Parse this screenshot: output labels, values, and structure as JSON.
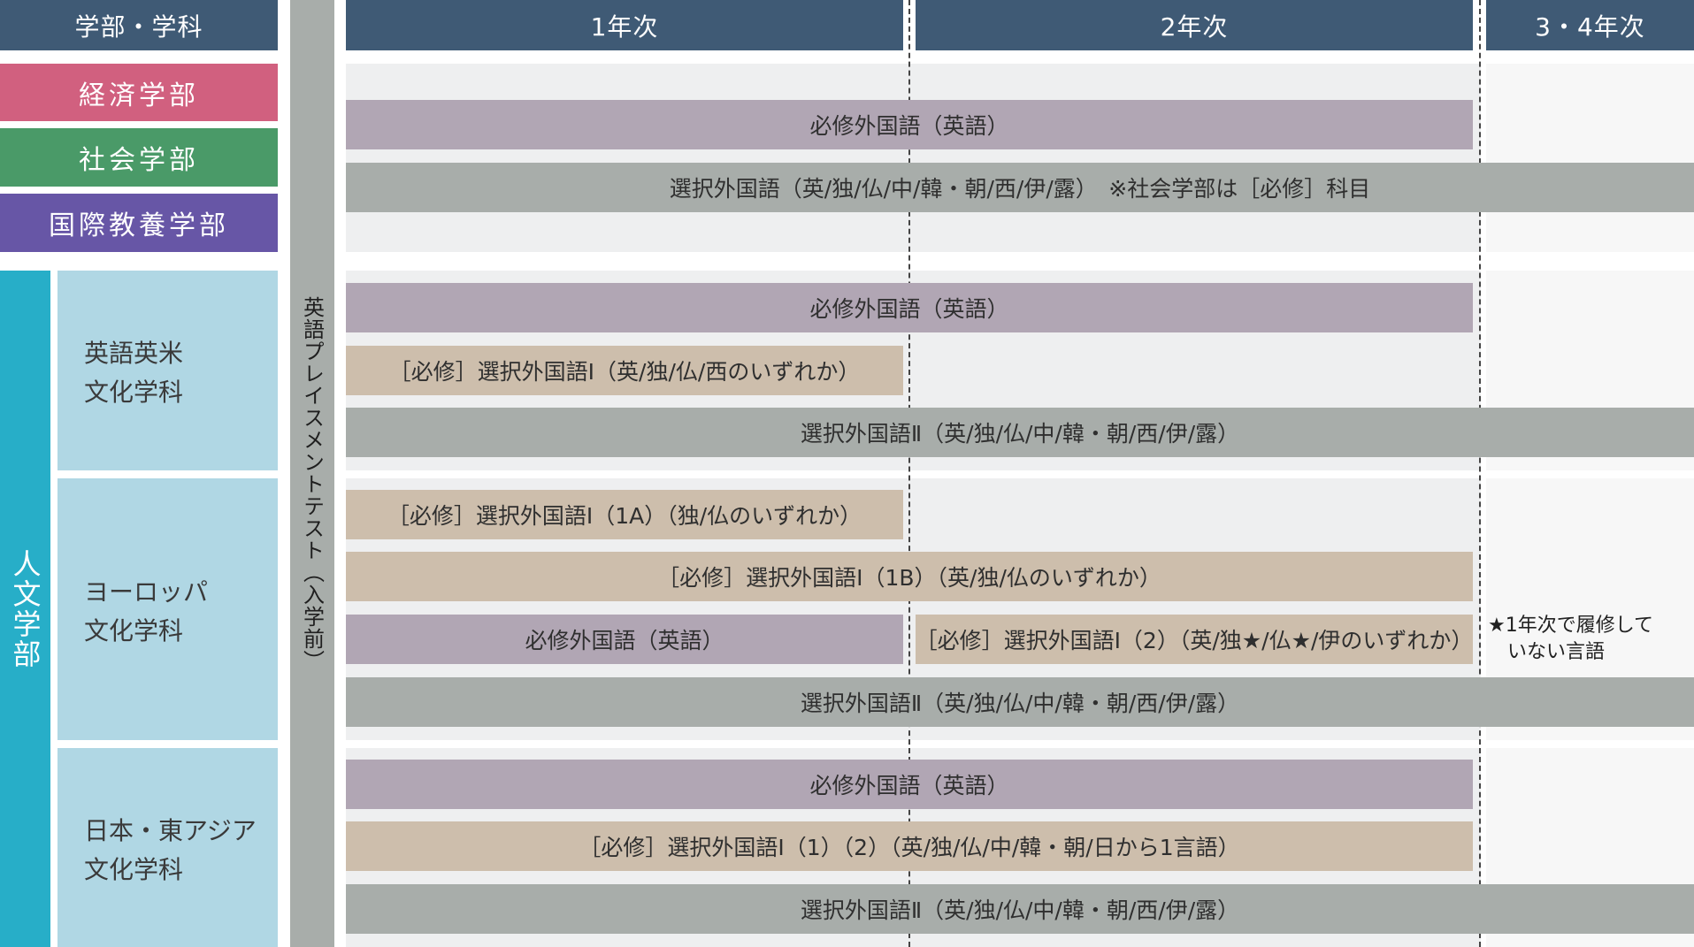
{
  "header": {
    "dept_label": "学部・学科",
    "year1": "1年次",
    "year2": "2年次",
    "year34": "3・4年次"
  },
  "departments": {
    "economics": "経済学部",
    "sociology": "社会学部",
    "liberal_arts": "国際教養学部",
    "humanities": "人文学部"
  },
  "subdepartments": {
    "english": [
      "英語英米",
      "文化学科"
    ],
    "europe": [
      "ヨーロッパ",
      "文化学科"
    ],
    "japan": [
      "日本・東アジア",
      "文化学科"
    ]
  },
  "placement_test": "英語プレイスメントテスト（入学前）",
  "courses": {
    "g1_required_english": "必修外国語（英語）",
    "g1_elective": "選択外国語（英/独/仏/中/韓・朝/西/伊/露）　※社会学部は［必修］科目",
    "g2_required_english": "必修外国語（英語）",
    "g2_elective_1": "［必修］選択外国語Ⅰ（英/独/仏/西のいずれか）",
    "g2_elective_2": "選択外国語Ⅱ（英/独/仏/中/韓・朝/西/伊/露）",
    "g3_elective_1a": "［必修］選択外国語Ⅰ（1A）（独/仏のいずれか）",
    "g3_elective_1b": "［必修］選択外国語Ⅰ（1B）（英/独/仏のいずれか）",
    "g3_required_english": "必修外国語（英語）",
    "g3_elective_2yr": "［必修］選択外国語Ⅰ（2）（英/独★/仏★/伊のいずれか）",
    "g3_elective_2": "選択外国語Ⅱ（英/独/仏/中/韓・朝/西/伊/露）",
    "g4_required_english": "必修外国語（英語）",
    "g4_elective_1": "［必修］選択外国語Ⅰ（1）（2）（英/独/仏/中/韓・朝/日から1言語）",
    "g4_elective_2": "選択外国語Ⅱ（英/独/仏/中/韓・朝/西/伊/露）"
  },
  "note": [
    "★1年次で履修して",
    "いない言語"
  ],
  "colors": {
    "header": "#3f5a75",
    "economics": "#d1607f",
    "sociology": "#4a9a68",
    "liberal_arts": "#6756a6",
    "humanities": "#27aec8",
    "subdept": "#b0d7e4",
    "required_english": "#b1a6b4",
    "elective": "#a8adaa",
    "required_elective": "#cdbeac"
  }
}
